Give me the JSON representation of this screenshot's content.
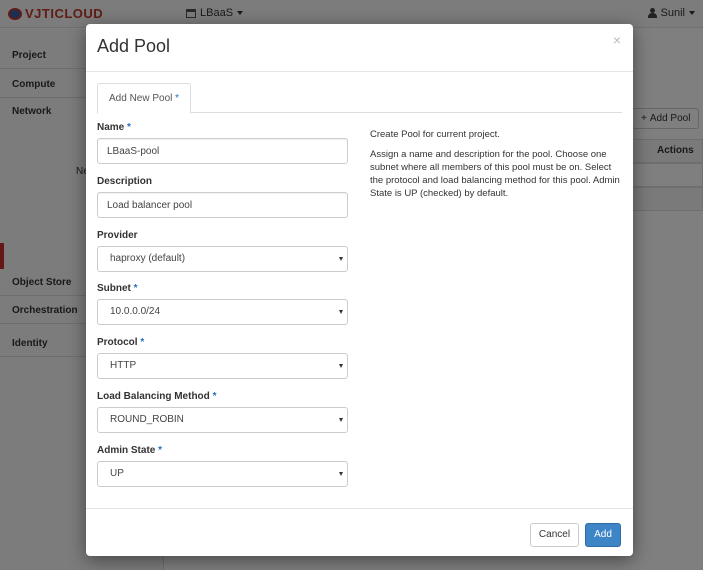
{
  "app": {
    "logo_text": "VJTICLOUD",
    "project_label": "LBaaS",
    "user_label": "Sunil"
  },
  "sidebar": {
    "items": [
      {
        "label": "Project"
      },
      {
        "label": "Compute"
      },
      {
        "label": "Network"
      },
      {
        "label": "Object Store"
      },
      {
        "label": "Orchestration"
      },
      {
        "label": "Identity"
      }
    ],
    "partial_text": "Ne"
  },
  "main": {
    "add_pool_label": "Add Pool",
    "actions_header": "Actions"
  },
  "modal": {
    "title": "Add Pool",
    "close_glyph": "×",
    "tab_label": "Add New Pool",
    "required_mark": "*",
    "fields": {
      "name": {
        "label": "Name",
        "value": "LBaaS-pool"
      },
      "description": {
        "label": "Description",
        "value": "Load balancer pool"
      },
      "provider": {
        "label": "Provider",
        "value": "haproxy (default)"
      },
      "subnet": {
        "label": "Subnet",
        "value": "10.0.0.0/24"
      },
      "protocol": {
        "label": "Protocol",
        "value": "HTTP"
      },
      "lb_method": {
        "label": "Load Balancing Method",
        "value": "ROUND_ROBIN"
      },
      "admin_state": {
        "label": "Admin State",
        "value": "UP"
      }
    },
    "help": {
      "line1": "Create Pool for current project.",
      "line2": "Assign a name and description for the pool. Choose one subnet where all members of this pool must be on. Select the protocol and load balancing method for this pool. Admin State is UP (checked) by default."
    },
    "buttons": {
      "cancel": "Cancel",
      "add": "Add"
    }
  },
  "colors": {
    "primary": "#3d85c6",
    "required": "#2a6ebb",
    "brand_red": "#c0392b"
  }
}
